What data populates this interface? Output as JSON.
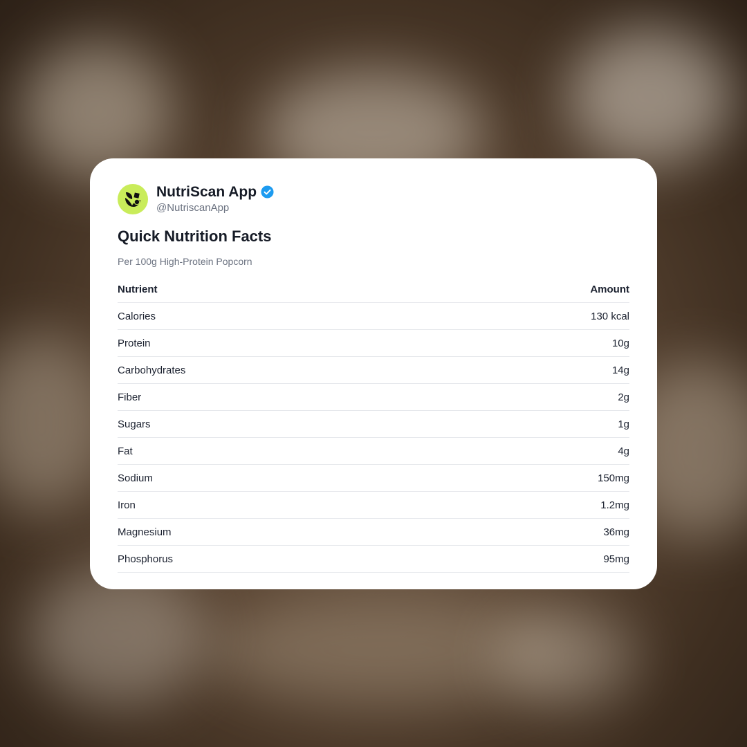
{
  "post": {
    "app_name": "NutriScan App",
    "handle": "@NutriscanApp",
    "verified": true,
    "avatar_icon": "leaf-logo-icon",
    "accent_color": "#c9ec5a",
    "verified_color": "#1d9bf0"
  },
  "facts": {
    "title": "Quick Nutrition Facts",
    "subtitle": "Per 100g High-Protein Popcorn",
    "columns": [
      "Nutrient",
      "Amount"
    ],
    "rows": [
      {
        "nutrient": "Calories",
        "amount": "130 kcal"
      },
      {
        "nutrient": "Protein",
        "amount": "10g"
      },
      {
        "nutrient": "Carbohydrates",
        "amount": "14g"
      },
      {
        "nutrient": "Fiber",
        "amount": "2g"
      },
      {
        "nutrient": "Sugars",
        "amount": "1g"
      },
      {
        "nutrient": "Fat",
        "amount": "4g"
      },
      {
        "nutrient": "Sodium",
        "amount": "150mg"
      },
      {
        "nutrient": "Iron",
        "amount": "1.2mg"
      },
      {
        "nutrient": "Magnesium",
        "amount": "36mg"
      },
      {
        "nutrient": "Phosphorus",
        "amount": "95mg"
      }
    ]
  }
}
